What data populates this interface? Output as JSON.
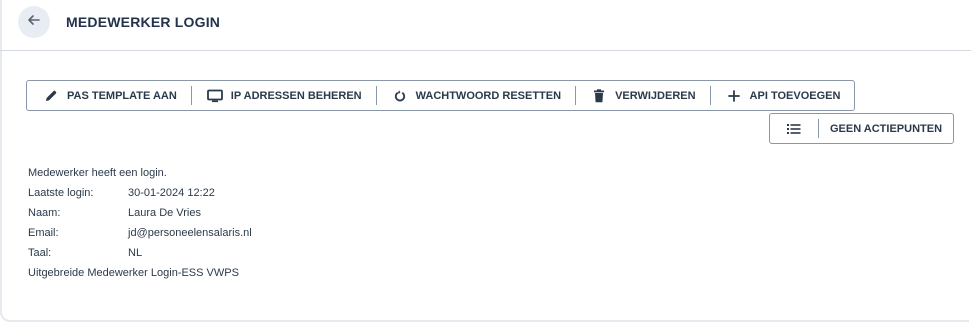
{
  "header": {
    "title": "MEDEWERKER LOGIN",
    "back_icon": "arrow-left-icon"
  },
  "toolbar": {
    "buttons": [
      {
        "label": "PAS TEMPLATE AAN",
        "icon": "pencil-icon"
      },
      {
        "label": "IP ADRESSEN BEHEREN",
        "icon": "monitor-icon"
      },
      {
        "label": "WACHTWOORD RESETTEN",
        "icon": "reset-icon"
      },
      {
        "label": "VERWIJDEREN",
        "icon": "trash-icon"
      },
      {
        "label": "API TOEVOEGEN",
        "icon": "plus-icon"
      }
    ]
  },
  "actions": {
    "label": "GEEN ACTIEPUNTEN",
    "icon": "list-icon"
  },
  "info": {
    "status": "Medewerker heeft een login.",
    "last_login_label": "Laatste login:",
    "last_login_value": "30-01-2024 12:22",
    "name_label": "Naam:",
    "name_value": "Laura De Vries",
    "email_label": "Email:",
    "email_value": "jd@personeelensalaris.nl",
    "language_label": "Taal:",
    "language_value": "NL",
    "extended": "Uitgebreide Medewerker Login-ESS VWPS"
  },
  "colors": {
    "border": "#8a97a8",
    "text": "#2b3a4a",
    "back_bg": "#e8edf3"
  }
}
